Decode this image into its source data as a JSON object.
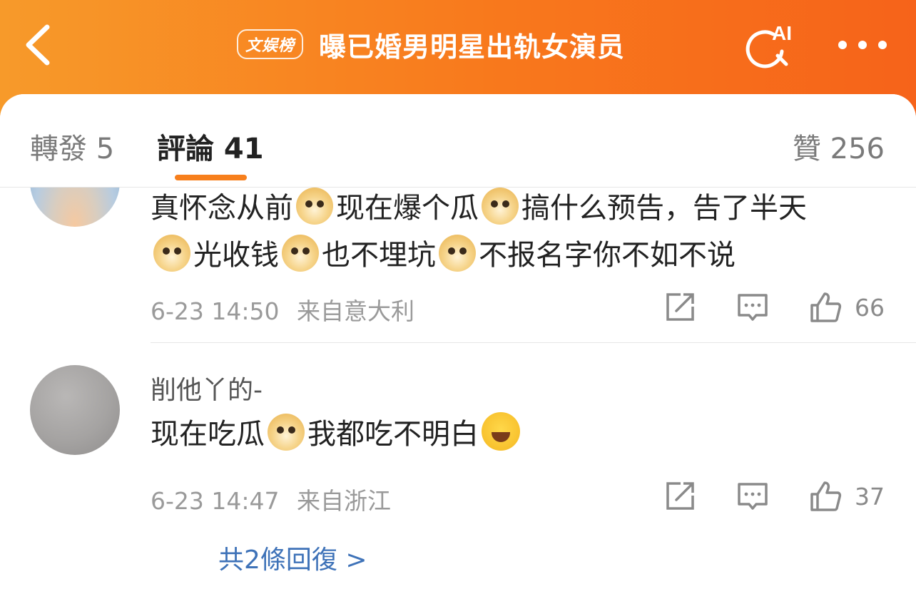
{
  "header": {
    "tag": "文娱榜",
    "title": "曝已婚男明星出轨女演员",
    "ai_label": "AI"
  },
  "tabs": {
    "forward": "轉發 5",
    "comments": "評論 41",
    "likes": "贊 256"
  },
  "comments": [
    {
      "segments": [
        "真怀念从前",
        "现在爆个瓜",
        "搞什么预告，告了半天",
        "光收钱",
        "也不埋坑",
        "不报名字你不如不说"
      ],
      "emoji": "doge",
      "time": "6-23 14:50",
      "location": "来自意大利",
      "likes": "66"
    },
    {
      "username": "削他丫的-",
      "segments": [
        "现在吃瓜",
        "我都吃不明白"
      ],
      "emoji": [
        "doge",
        "laughing-crying"
      ],
      "time": "6-23 14:47",
      "location": "来自浙江",
      "likes": "37",
      "replies_link": "共2條回復 >"
    }
  ],
  "colors": {
    "header_orange": "#f8781c",
    "accent_underline": "#f77f1c",
    "link_blue": "#3e72b8"
  },
  "icons": [
    "back-icon",
    "ai-search-icon",
    "more-icon",
    "repost-icon",
    "reply-icon",
    "like-icon",
    "doge-emoji",
    "laughing-crying-emoji"
  ]
}
